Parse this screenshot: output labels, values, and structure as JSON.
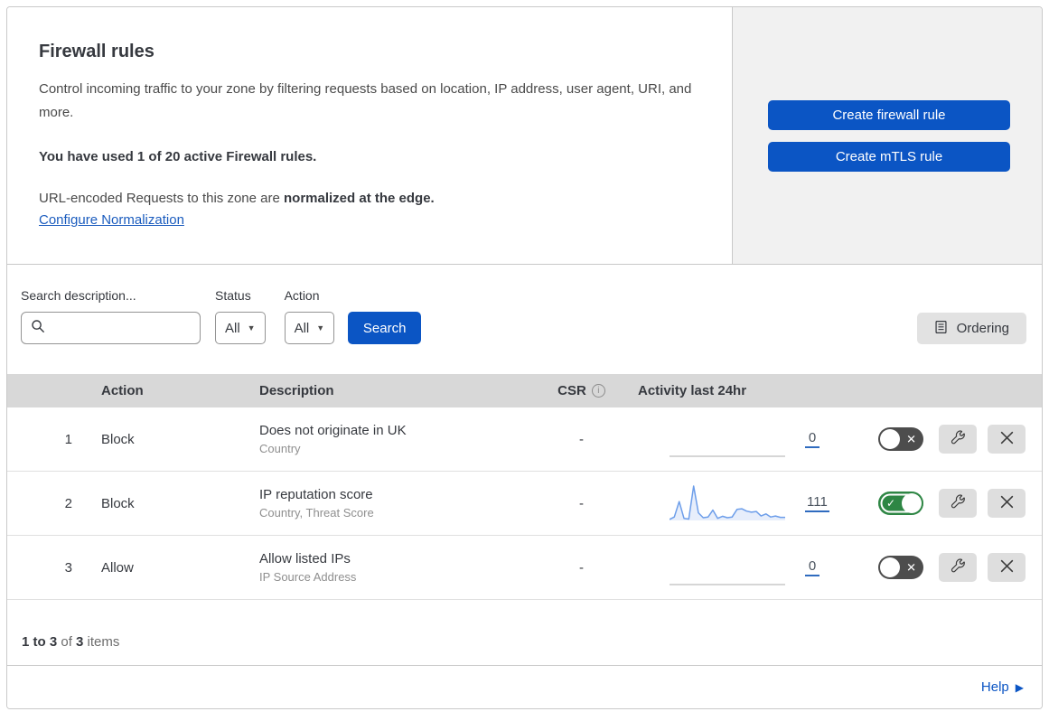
{
  "header": {
    "title": "Firewall rules",
    "description": "Control incoming traffic to your zone by filtering requests based on location, IP address, user agent, URI, and more.",
    "usage": "You have used 1 of 20 active Firewall rules.",
    "normalization_prefix": "URL-encoded Requests to this zone are ",
    "normalization_bold": "normalized at the edge.",
    "normalization_link": "Configure Normalization",
    "create_firewall_label": "Create firewall rule",
    "create_mtls_label": "Create mTLS rule"
  },
  "filters": {
    "search_label": "Search description...",
    "search_value": "",
    "status_label": "Status",
    "status_value": "All",
    "action_label": "Action",
    "action_value": "All",
    "search_button": "Search",
    "ordering_button": "Ordering"
  },
  "table": {
    "columns": {
      "action": "Action",
      "description": "Description",
      "csr": "CSR",
      "activity": "Activity last 24hr"
    },
    "rows": [
      {
        "index": "1",
        "action": "Block",
        "description": "Does not originate in UK",
        "fields": "Country",
        "csr": "-",
        "activity_count": "0",
        "enabled": false,
        "sparkline": []
      },
      {
        "index": "2",
        "action": "Block",
        "description": "IP reputation score",
        "fields": "Country, Threat Score",
        "csr": "-",
        "activity_count": "111",
        "enabled": true,
        "sparkline": [
          3,
          10,
          55,
          6,
          4,
          100,
          22,
          8,
          10,
          30,
          6,
          12,
          8,
          10,
          32,
          34,
          27,
          24,
          26,
          13,
          19,
          10,
          13,
          9,
          9
        ]
      },
      {
        "index": "3",
        "action": "Allow",
        "description": "Allow listed IPs",
        "fields": "IP Source Address",
        "csr": "-",
        "activity_count": "0",
        "enabled": false,
        "sparkline": []
      }
    ]
  },
  "footer": {
    "range_bold": "1 to 3",
    "of_text": " of ",
    "total_bold": "3",
    "items_text": " items"
  },
  "help": {
    "label": "Help"
  },
  "icons": {
    "toggle_on_mark": "✓",
    "toggle_off_mark": "✕",
    "dropdown_caret": "▼",
    "help_arrow": "▶"
  },
  "colors": {
    "accent_blue": "#0b55c4",
    "link_blue": "#1b5cbe",
    "toggle_green": "#2e8644",
    "toggle_off_gray": "#4d4d4d",
    "spark_line": "#6d9eea",
    "spark_fill": "rgba(122,160,234,0.18)",
    "flat_line": "#c9c9c9"
  }
}
